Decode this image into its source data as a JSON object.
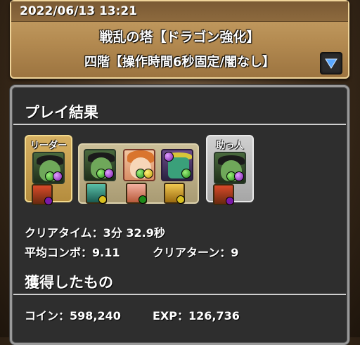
{
  "header": {
    "date": "2022/06/13 13:21",
    "title": "戦乱の塔【ドラゴン強化】",
    "subtitle": "四階【操作時間6秒固定/闇なし】",
    "dropdown_icon": "triangle-down-icon"
  },
  "result": {
    "section_title": "プレイ結果",
    "leader_label": "リーダー",
    "helper_label": "助っ人",
    "stats": {
      "clear_time": "クリアタイム：3分 32.9秒",
      "avg_combo": "平均コンボ：9.11",
      "clear_turns": "クリアターン：9"
    }
  },
  "rewards": {
    "section_title": "獲得したもの",
    "coins": "コイン：598,240",
    "exp": "EXP：126,736"
  },
  "colors": {
    "accent_gold": "#d6b062",
    "panel_bg": "#2e2e2e",
    "header_bg": "#b58c52"
  },
  "team": {
    "leader": {
      "monster": "green-witch",
      "assist": "red-mage"
    },
    "subs": [
      {
        "monster": "green-witch",
        "assist": "teal-weapon"
      },
      {
        "monster": "orange-girl",
        "assist": "pink-weapon"
      },
      {
        "monster": "purple-dragon",
        "assist": "gold-weapon"
      }
    ],
    "helper": {
      "monster": "green-witch",
      "assist": "red-mage"
    }
  }
}
